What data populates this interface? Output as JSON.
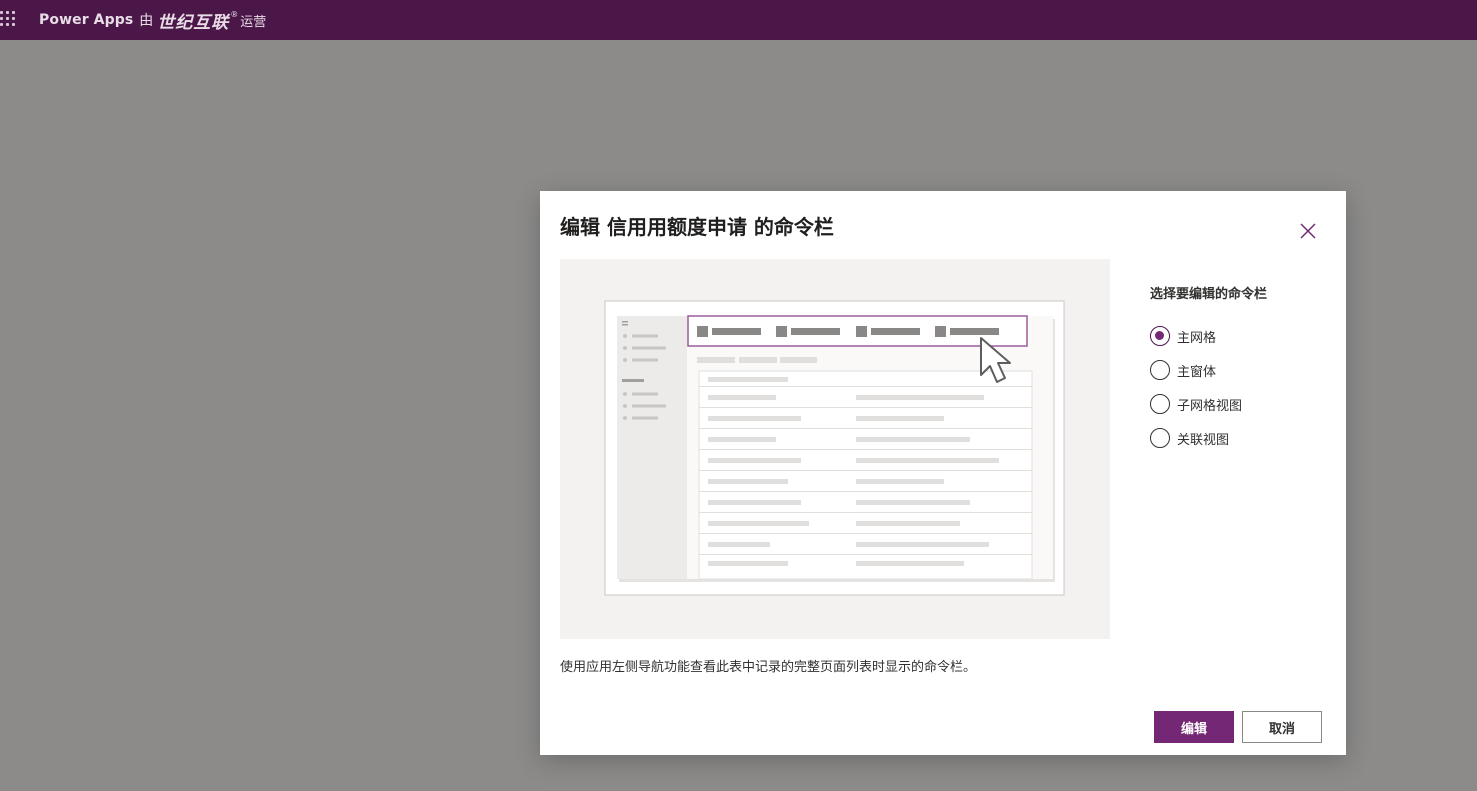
{
  "topbar": {
    "product": "Power Apps",
    "by": "由",
    "company": "世纪互联",
    "registered": "®",
    "operated": "运营",
    "waffle_icon": "waffle-icon",
    "color": "#4b1648"
  },
  "dialog": {
    "title": "编辑 信用用额度申请 的命令栏",
    "close_icon": "close-icon",
    "caption": "使用应用左侧导航功能查看此表中记录的完整页面列表时显示的命令栏。",
    "options_label": "选择要编辑的命令栏",
    "options": [
      {
        "label": "主网格",
        "selected": true
      },
      {
        "label": "主窗体",
        "selected": false
      },
      {
        "label": "子网格视图",
        "selected": false
      },
      {
        "label": "关联视图",
        "selected": false
      }
    ],
    "buttons": {
      "edit": "编辑",
      "cancel": "取消"
    },
    "accent": "#742774"
  }
}
